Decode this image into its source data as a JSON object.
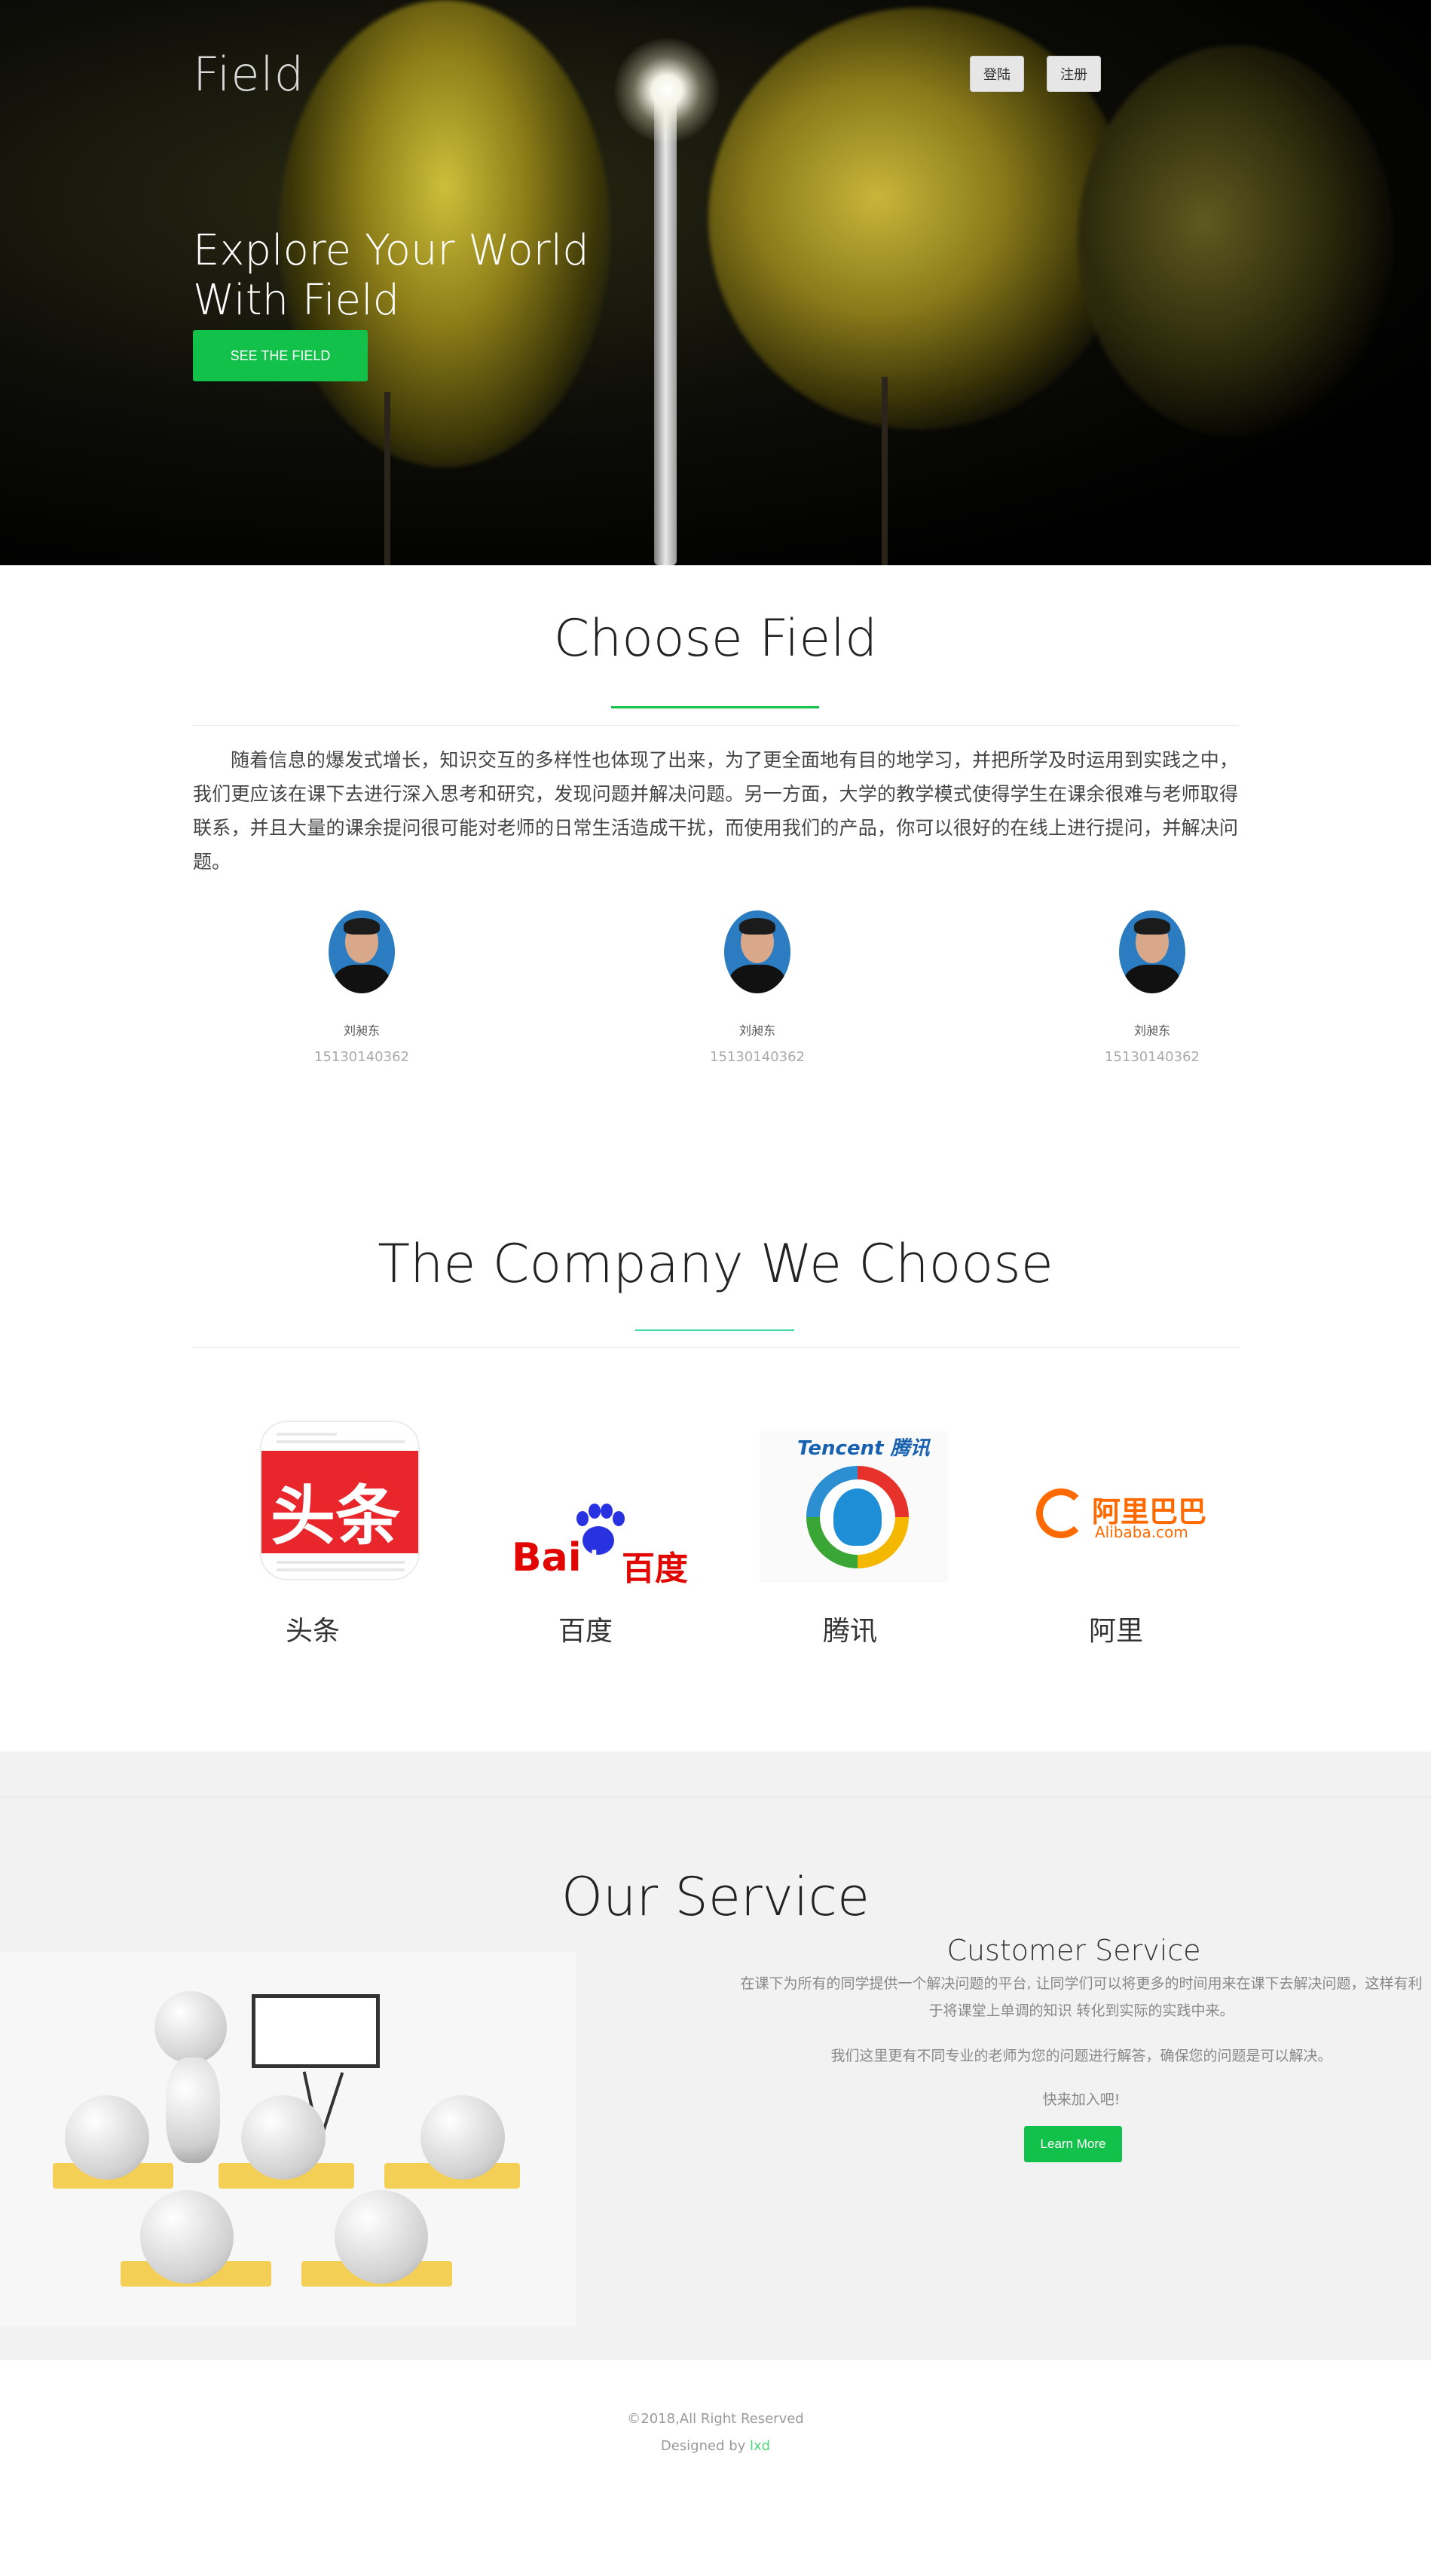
{
  "header": {
    "brand": "Field",
    "login_label": "登陆",
    "register_label": "注册"
  },
  "hero": {
    "title_line1": "Explore Your World",
    "title_line2": "With Field",
    "cta_label": "SEE THE FIELD"
  },
  "choose_field": {
    "title": "Choose Field",
    "intro": "随着信息的爆发式增长，知识交互的多样性也体现了出来，为了更全面地有目的地学习，并把所学及时运用到实践之中，我们更应该在课下去进行深入思考和研究，发现问题并解决问题。另一方面，大学的教学模式使得学生在课余很难与老师取得联系，并且大量的课余提问很可能对老师的日常生活造成干扰，而使用我们的产品，你可以很好的在线上进行提问，并解决问题。",
    "members": [
      {
        "name": "刘昶东",
        "id": "15130140362"
      },
      {
        "name": "刘昶东",
        "id": "15130140362"
      },
      {
        "name": "刘昶东",
        "id": "15130140362"
      }
    ]
  },
  "company": {
    "title": "The Company We Choose",
    "items": [
      {
        "label": "头条",
        "logo": "toutiao-logo",
        "logo_text": "头条"
      },
      {
        "label": "百度",
        "logo": "baidu-logo",
        "logo_text_1": "Bai",
        "logo_text_2": "du",
        "logo_text_3": "百度"
      },
      {
        "label": "腾讯",
        "logo": "tencent-logo",
        "logo_text": "Tencent 腾讯"
      },
      {
        "label": "阿里",
        "logo": "alibaba-logo",
        "logo_text_cn": "阿里巴巴",
        "logo_text_en": "Alibaba.com"
      }
    ]
  },
  "service": {
    "title": "Our Service",
    "subtitle": "Customer Service",
    "p1": "在课下为所有的同学提供一个解决问题的平台, 让同学们可以将更多的时间用来在课下去解决问题，这样有利于将课堂上单调的知识 转化到实际的实践中来。",
    "p2": "我们这里更有不同专业的老师为您的问题进行解答，确保您的问题是可以解决。",
    "p3": "快来加入吧!",
    "button_label": "Learn More"
  },
  "footer": {
    "copyright": "©2018,All Right Reserved",
    "designed_prefix": "Designed by ",
    "designer": "lxd"
  },
  "colors": {
    "accent_green": "#12c14a",
    "teal_line": "#3ed9a8"
  }
}
